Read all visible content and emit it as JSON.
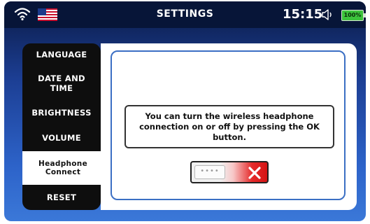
{
  "status_bar": {
    "title": "SETTINGS",
    "time": "15:15",
    "battery": "100%",
    "icons": [
      "wifi-icon",
      "us-flag-icon",
      "speaker-icon",
      "battery-icon"
    ]
  },
  "menu": {
    "items": [
      {
        "label": "LANGUAGE"
      },
      {
        "label": "DATE AND TIME"
      },
      {
        "label": "BRIGHTNESS"
      },
      {
        "label": "VOLUME"
      },
      {
        "label": "Headphone Connect",
        "selected": true
      },
      {
        "label": "RESET"
      }
    ]
  },
  "panel": {
    "message": "You can turn the wireless headphone connection on or off by pressing the OK button.",
    "toggle": {
      "state": "off",
      "knob_text": "••••",
      "icon": "close-icon"
    }
  },
  "colors": {
    "background_top": "#0a1a45",
    "background_bottom": "#3b78d8",
    "accent_border": "#3b6fc4",
    "off_red": "#e52a2a",
    "battery_green": "#3cc33c"
  }
}
